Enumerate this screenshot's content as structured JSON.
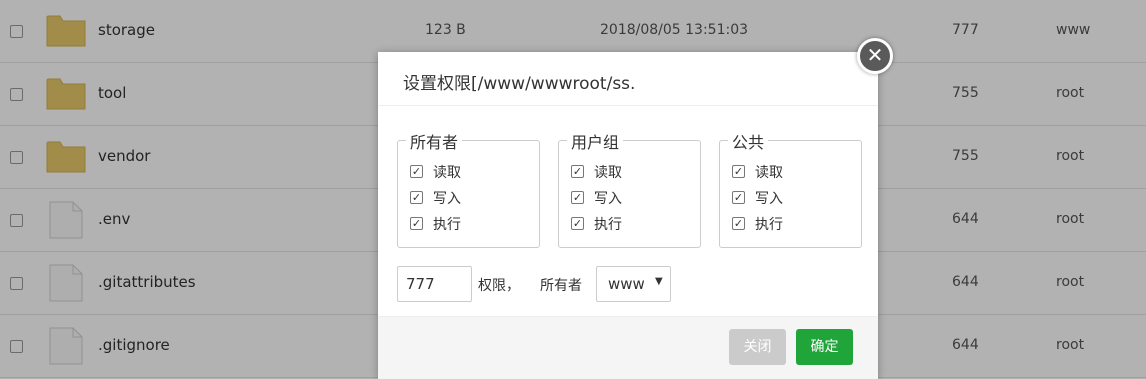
{
  "files": [
    {
      "name": "storage",
      "type": "folder",
      "size": "123 B",
      "date": "2018/08/05 13:51:03",
      "perm": "777",
      "owner": "www"
    },
    {
      "name": "tool",
      "type": "folder",
      "size": "",
      "date": "",
      "perm": "755",
      "owner": "root"
    },
    {
      "name": "vendor",
      "type": "folder",
      "size": "",
      "date": "",
      "perm": "755",
      "owner": "root"
    },
    {
      "name": ".env",
      "type": "file",
      "size": "",
      "date": "",
      "perm": "644",
      "owner": "root"
    },
    {
      "name": ".gitattributes",
      "type": "file",
      "size": "",
      "date": "",
      "perm": "644",
      "owner": "root"
    },
    {
      "name": ".gitignore",
      "type": "file",
      "size": "",
      "date": "",
      "perm": "644",
      "owner": "root"
    }
  ],
  "dialog": {
    "title": "设置权限[/www/wwwroot/ss.",
    "close_icon": "close-icon",
    "groups": [
      {
        "legend": "所有者",
        "options": [
          {
            "label": "读取",
            "checked": true
          },
          {
            "label": "写入",
            "checked": true
          },
          {
            "label": "执行",
            "checked": true
          }
        ]
      },
      {
        "legend": "用户组",
        "options": [
          {
            "label": "读取",
            "checked": true
          },
          {
            "label": "写入",
            "checked": true
          },
          {
            "label": "执行",
            "checked": true
          }
        ]
      },
      {
        "legend": "公共",
        "options": [
          {
            "label": "读取",
            "checked": true
          },
          {
            "label": "写入",
            "checked": true
          },
          {
            "label": "执行",
            "checked": true
          }
        ]
      }
    ],
    "perm_value": "777",
    "perm_label": "权限，",
    "owner_label": "所有者",
    "owner_value": "www",
    "close_label": "关闭",
    "ok_label": "确定"
  },
  "colors": {
    "folder": "#e8c96a",
    "ok_button": "#20a53a",
    "close_button": "#cbcbcb"
  }
}
